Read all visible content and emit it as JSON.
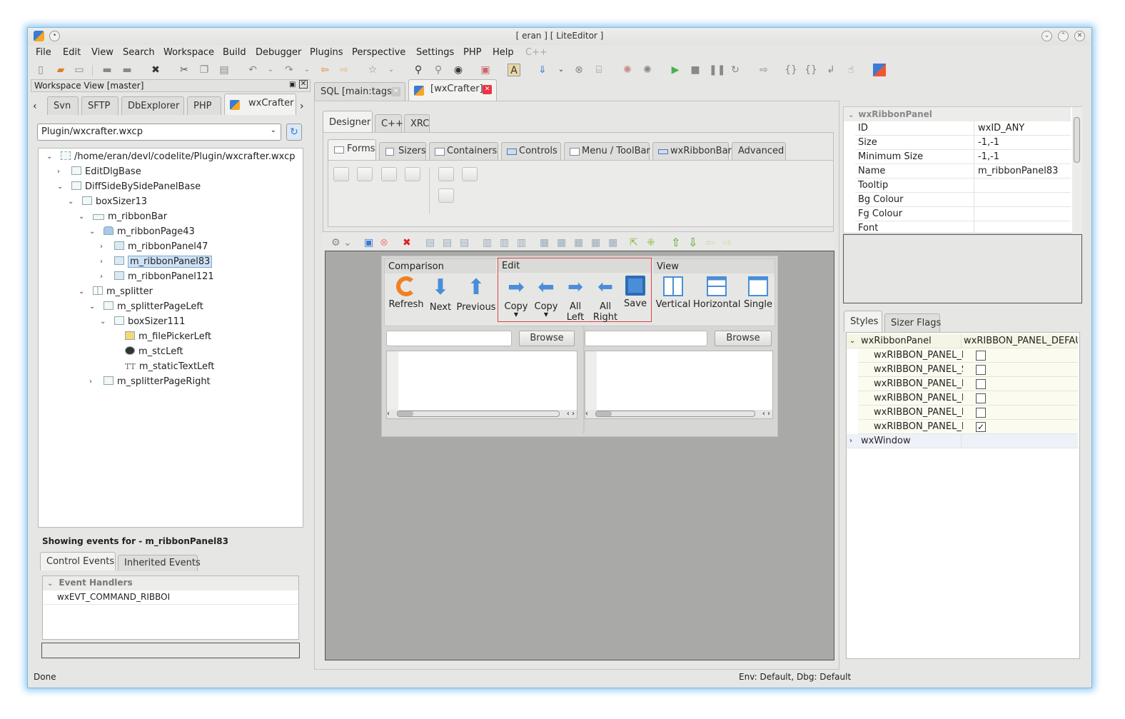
{
  "window": {
    "title": "[ eran ] [ LiteEditor ]"
  },
  "menu": [
    "File",
    "Edit",
    "View",
    "Search",
    "Workspace",
    "Build",
    "Debugger",
    "Plugins",
    "Perspective",
    "Settings",
    "PHP",
    "Help",
    "C++"
  ],
  "workspace": {
    "title": "Workspace View [master]",
    "tabs": [
      "Svn",
      "SFTP",
      "DbExplorer",
      "PHP",
      "wxCrafter"
    ],
    "file_combo": "Plugin/wxcrafter.wxcp",
    "tree": [
      "/home/eran/devl/codelite/Plugin/wxcrafter.wxcp",
      "EditDlgBase",
      "DiffSideBySidePanelBase",
      "boxSizer13",
      "m_ribbonBar",
      "m_ribbonPage43",
      "m_ribbonPanel47",
      "m_ribbonPanel83",
      "m_ribbonPanel121",
      "m_splitter",
      "m_splitterPageLeft",
      "boxSizer111",
      "m_filePickerLeft",
      "m_stcLeft",
      "m_staticTextLeft",
      "m_splitterPageRight"
    ]
  },
  "events": {
    "showing": "Showing events for - m_ribbonPanel83",
    "tabs": [
      "Control Events",
      "Inherited Events"
    ],
    "group": "Event Handlers",
    "item": "wxEVT_COMMAND_RIBBOI"
  },
  "editor_tabs": [
    "SQL [main:tags]",
    "[wxCrafter]"
  ],
  "designer": {
    "tabs": [
      "Designer",
      "C++",
      "XRC"
    ],
    "palette_tabs": [
      "Forms",
      "Sizers",
      "Containers",
      "Controls",
      "Menu / ToolBar",
      "wxRibbonBar",
      "Advanced"
    ]
  },
  "ribbon": {
    "panels": [
      {
        "title": "Comparison",
        "buttons": [
          "Refresh",
          "Next",
          "Previous"
        ]
      },
      {
        "title": "Edit",
        "buttons": [
          "Copy",
          "Copy",
          "All\nLeft",
          "All\nRight",
          "Save"
        ]
      },
      {
        "title": "View",
        "buttons": [
          "Vertical",
          "Horizontal",
          "Single"
        ]
      }
    ],
    "browse": "Browse"
  },
  "props": {
    "header": "wxRibbonPanel",
    "rows": [
      [
        "ID",
        "wxID_ANY"
      ],
      [
        "Size",
        "-1,-1"
      ],
      [
        "Minimum Size",
        "-1,-1"
      ],
      [
        "Name",
        "m_ribbonPanel83"
      ],
      [
        "Tooltip",
        ""
      ],
      [
        "Bg Colour",
        ""
      ],
      [
        "Fg Colour",
        ""
      ],
      [
        "Font",
        ""
      ]
    ]
  },
  "styles": {
    "tabs": [
      "Styles",
      "Sizer Flags"
    ],
    "root": "wxRibbonPanel",
    "root_value": "wxRIBBON_PANEL_DEFAUL",
    "flags": [
      [
        "wxRIBBON_PANEL_FI",
        false
      ],
      [
        "wxRIBBON_PANEL_S",
        false
      ],
      [
        "wxRIBBON_PANEL_N",
        false
      ],
      [
        "wxRIBBON_PANEL_E",
        false
      ],
      [
        "wxRIBBON_PANEL_N",
        false
      ],
      [
        "wxRIBBON_PANEL_D",
        true
      ]
    ],
    "next": "wxWindow"
  },
  "status": {
    "left": "Done",
    "right": "Env: Default, Dbg: Default"
  }
}
